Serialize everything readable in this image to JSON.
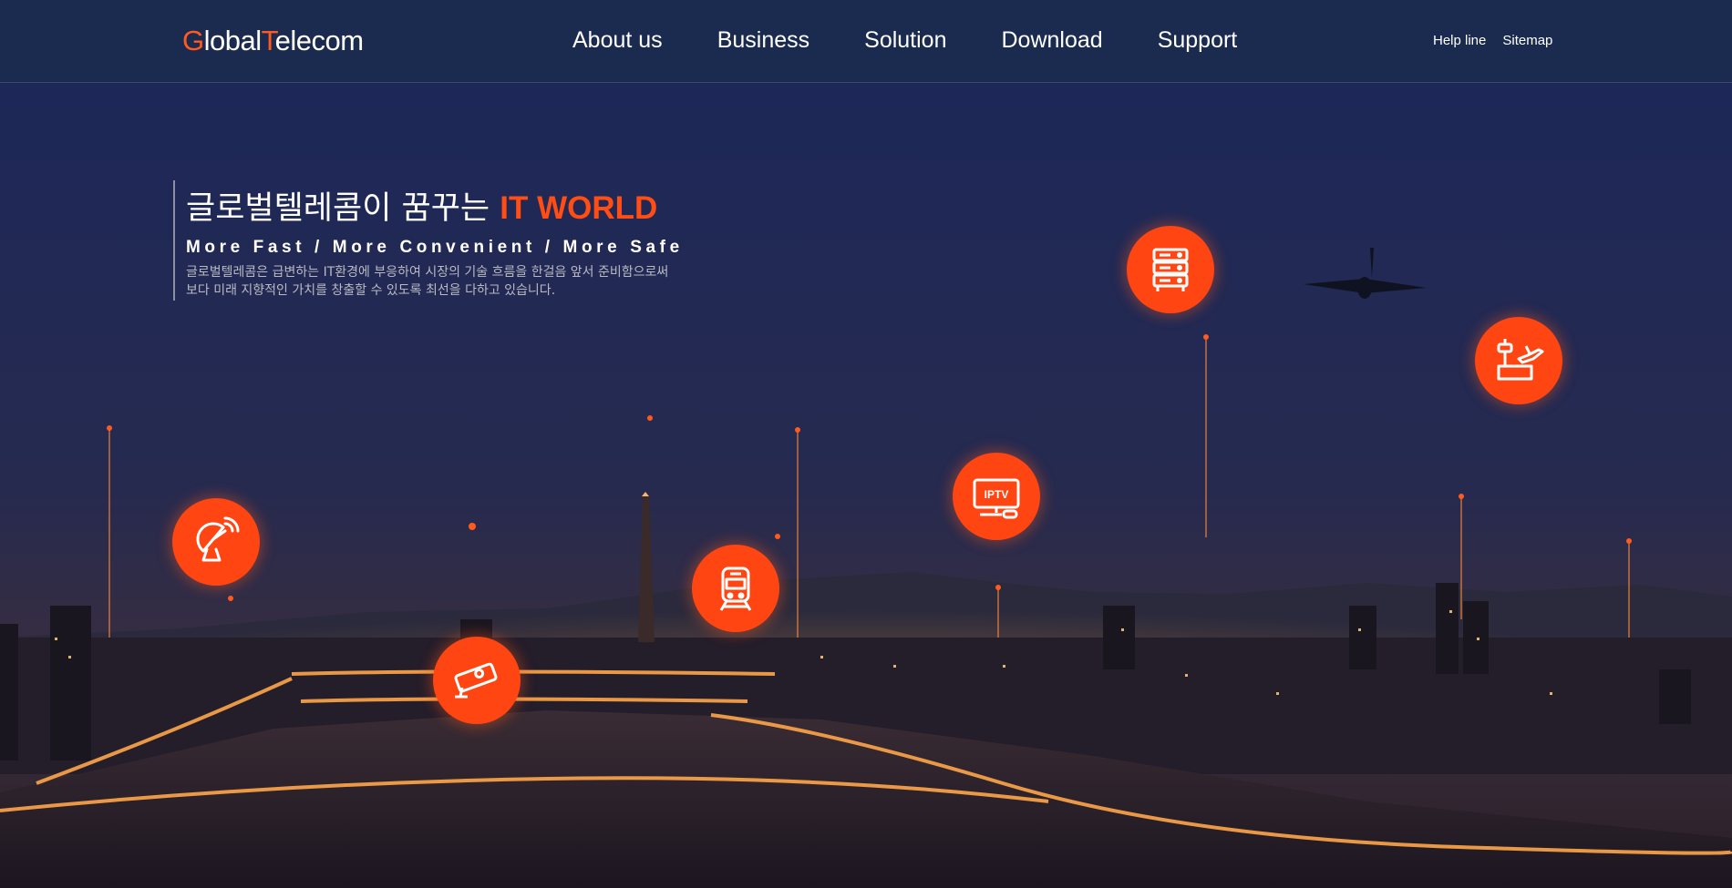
{
  "header": {
    "logo": {
      "g": "G",
      "lobal": "lobal",
      "t": "T",
      "elecom": "elecom"
    },
    "nav": [
      "About us",
      "Business",
      "Solution",
      "Download",
      "Support"
    ],
    "utility": [
      "Help line",
      "Sitemap"
    ]
  },
  "hero": {
    "title_prefix": "글로벌텔레콤이 꿈꾸는 ",
    "title_highlight": "IT WORLD",
    "tagline": "More Fast / More Convenient / More Safe",
    "description": [
      "글로벌텔레콤은 급변하는 IT환경에 부응하여 시장의 기술 흐름을 한걸음 앞서 준비함으로써",
      "보다 미래 지향적인 가치를 창출할 수 있도록 최선을 다하고 있습니다."
    ]
  },
  "service_icons": [
    {
      "icon": "satellite-dish-icon"
    },
    {
      "icon": "cctv-camera-icon"
    },
    {
      "icon": "train-icon"
    },
    {
      "icon": "iptv-icon",
      "label": "IPTV"
    },
    {
      "icon": "server-icon"
    },
    {
      "icon": "airport-icon"
    }
  ],
  "colors": {
    "accent": "#ff4512",
    "header_bg": "#1b2a4f",
    "sky": "#1e2956"
  }
}
